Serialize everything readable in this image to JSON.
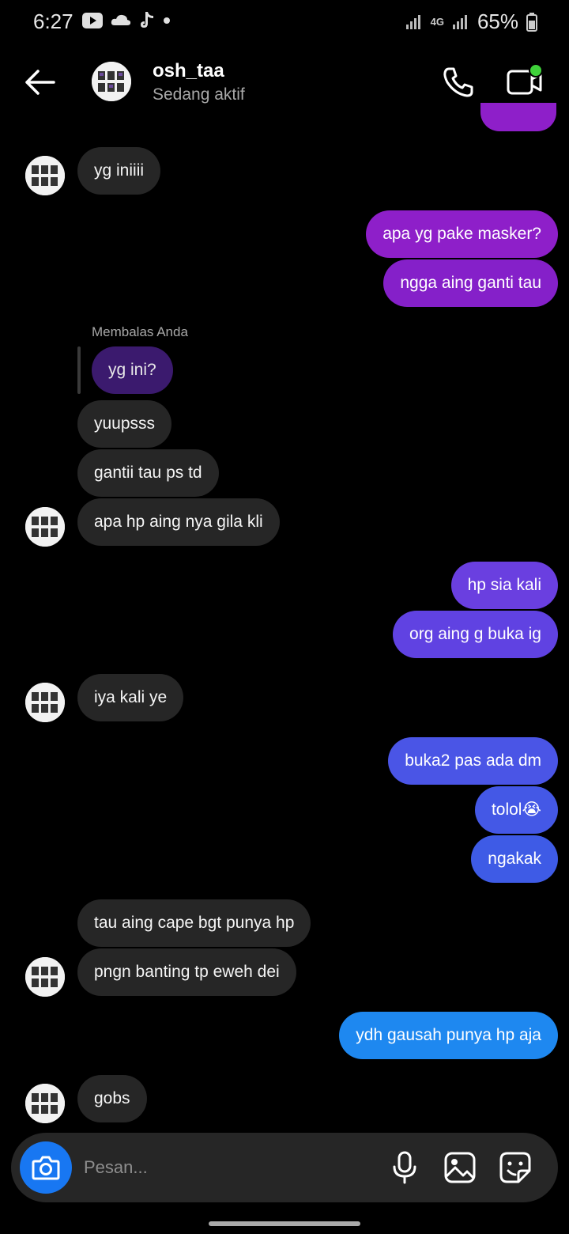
{
  "status_bar": {
    "time": "6:27",
    "battery": "65%",
    "network": "4G"
  },
  "header": {
    "username": "osh_taa",
    "status": "Sedang aktif"
  },
  "reply": {
    "label": "Membalas Anda",
    "quoted_text": "yg ini?"
  },
  "messages": [
    {
      "text": "yg iniiii"
    },
    {
      "text": "apa yg pake masker?"
    },
    {
      "text": "ngga aing ganti tau"
    },
    {
      "text": "yuupsss"
    },
    {
      "text": "gantii tau ps td"
    },
    {
      "text": "apa hp aing nya gila kli"
    },
    {
      "text": "hp sia kali"
    },
    {
      "text": "org aing g buka ig"
    },
    {
      "text": "iya kali ye"
    },
    {
      "text": "buka2 pas ada dm"
    },
    {
      "text": "tolol😭"
    },
    {
      "text": "ngakak"
    },
    {
      "text": "tau aing cape bgt punya hp"
    },
    {
      "text": "pngn banting tp eweh dei"
    },
    {
      "text": "ydh gausah punya hp aja"
    },
    {
      "text": "gobs"
    }
  ],
  "composer": {
    "placeholder": "Pesan..."
  },
  "colors": {
    "incoming": "#262626",
    "outgoing_top": "#8e1fc9",
    "outgoing_bottom": "#1e88f0",
    "camera": "#1877f2"
  },
  "icons": [
    "back-arrow-icon",
    "phone-icon",
    "video-call-icon",
    "camera-icon",
    "microphone-icon",
    "gallery-icon",
    "sticker-icon"
  ]
}
